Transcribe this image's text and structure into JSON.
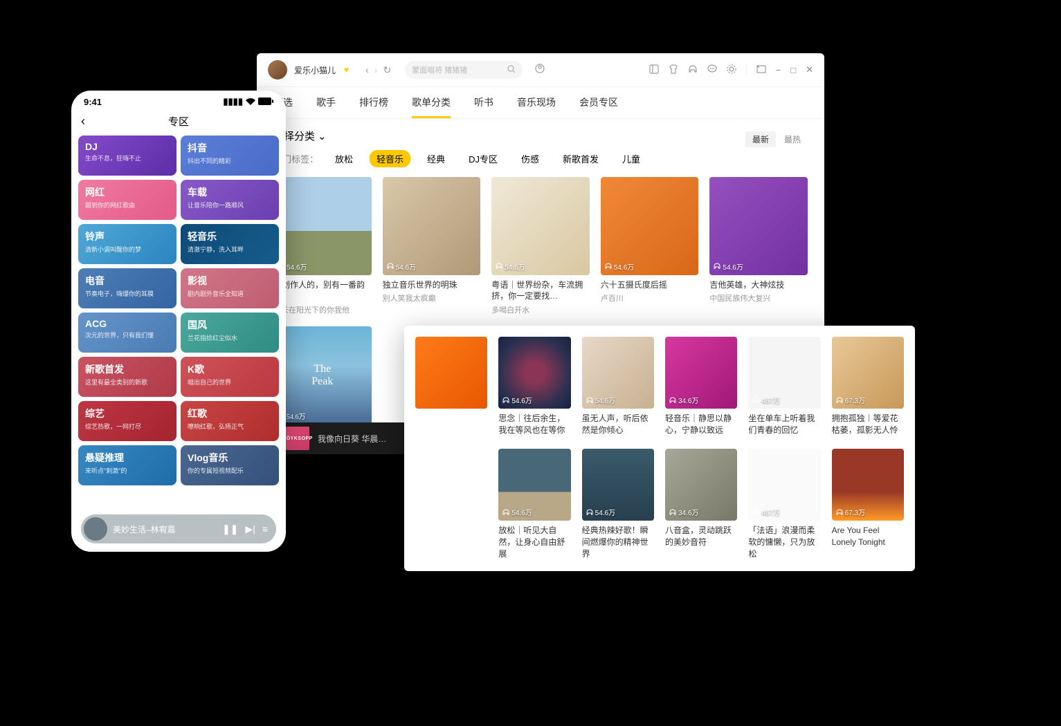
{
  "mobile": {
    "time": "9:41",
    "title": "专区",
    "categories": [
      {
        "title": "DJ",
        "sub": "生命不息，狂嗨不止",
        "cls": "c-dj"
      },
      {
        "title": "抖音",
        "sub": "抖出不同的精彩",
        "cls": "c-douyin"
      },
      {
        "title": "网红",
        "sub": "甜到你的网红歌曲",
        "cls": "c-wanghong"
      },
      {
        "title": "车载",
        "sub": "让音乐陪你一路顺风",
        "cls": "c-chezai"
      },
      {
        "title": "铃声",
        "sub": "清新小调叫醒你的梦",
        "cls": "c-lingsheng"
      },
      {
        "title": "轻音乐",
        "sub": "清澈宁静，洗入耳畔",
        "cls": "c-qingyinyue"
      },
      {
        "title": "电音",
        "sub": "节奏电子，嗨爆你的耳膜",
        "cls": "c-dianyin"
      },
      {
        "title": "影视",
        "sub": "剧内剧外音乐全知道",
        "cls": "c-yingshi"
      },
      {
        "title": "ACG",
        "sub": "次元的世界，只有我们懂",
        "cls": "c-acg"
      },
      {
        "title": "国风",
        "sub": "兰花指捻红尘似水",
        "cls": "c-guofeng"
      },
      {
        "title": "新歌首发",
        "sub": "这里有最全类别的新歌",
        "cls": "c-xinge"
      },
      {
        "title": "K歌",
        "sub": "唱出自己的世界",
        "cls": "c-kge"
      },
      {
        "title": "综艺",
        "sub": "综艺热歌，一网打尽",
        "cls": "c-zongyi"
      },
      {
        "title": "红歌",
        "sub": "嘹响红歌，弘扬正气",
        "cls": "c-hongge"
      },
      {
        "title": "悬疑推理",
        "sub": "来听点\"刺激\"的",
        "cls": "c-xuanyi"
      },
      {
        "title": "Vlog音乐",
        "sub": "你的专属短视频配乐",
        "cls": "c-vlog"
      }
    ],
    "now_playing": "美妙生活–林宥嘉"
  },
  "desktop": {
    "username": "爱乐小猫儿",
    "search_placeholder": "蒙面唱将 猪猪猪",
    "tabs": [
      "精选",
      "歌手",
      "排行榜",
      "歌单分类",
      "听书",
      "音乐现场",
      "会员专区"
    ],
    "active_tab": 3,
    "section_title": "选择分类",
    "sort": {
      "newest": "最新",
      "hottest": "最热"
    },
    "tag_label": "热门标签：",
    "tags": [
      "放松",
      "轻音乐",
      "经典",
      "DJ专区",
      "伤感",
      "新歌首发",
      "儿童"
    ],
    "active_tag": 1,
    "playlists_row1": [
      {
        "plays": "54.6万",
        "title": "听创作人的，别有一番韵味",
        "sub": "生长在阳光下的你我他",
        "cover": "pc-sky"
      },
      {
        "plays": "54.6万",
        "title": "独立音乐世界的明珠",
        "sub": "别人笑我太疯癫",
        "cover": "pc-girl"
      },
      {
        "plays": "54.6万",
        "title": "粤语｜世界纷杂，车流拥挤，你一定要找…",
        "sub": "多喝白开水",
        "cover": "pc-shapes"
      },
      {
        "plays": "54.6万",
        "title": "六十五摄氏度后摇",
        "sub": "卢百川",
        "cover": "pc-orange"
      },
      {
        "plays": "54.6万",
        "title": "吉他英雄，大神炫技",
        "sub": "中国民族伟大复兴",
        "cover": "pc-glasses"
      }
    ],
    "peak": {
      "line1": "The",
      "line2": "Peak",
      "plays": "54.6万"
    },
    "player_song": "我像向日葵 华晨…"
  },
  "panel": {
    "row1": [
      {
        "plays": "",
        "title": "",
        "cover": "pc-oranger",
        "show_plays": false
      },
      {
        "plays": "54.6万",
        "title": "思念｜往后余生，我在等风也在等你",
        "cover": "pc-disc",
        "show_plays": true
      },
      {
        "plays": "54.6万",
        "title": "虽无人声，听后依然是你倾心",
        "cover": "pc-solo",
        "show_plays": true
      },
      {
        "plays": "34.6万",
        "title": "轻音乐｜静思以静心，宁静以致远",
        "cover": "pc-escape",
        "show_plays": true
      },
      {
        "plays": "467万",
        "title": "坐在单车上听着我们青春的回忆",
        "cover": "pc-white",
        "show_plays": true
      },
      {
        "plays": "67.3万",
        "title": "拥抱孤独｜等爱花枯萎，孤影无人怜",
        "cover": "pc-skin",
        "show_plays": true
      }
    ],
    "row2": [
      {
        "plays": "",
        "title": "",
        "cover": "",
        "hidden": true
      },
      {
        "plays": "54.6万",
        "title": "放松｜听见大自然，让身心自由舒展",
        "cover": "pc-dragons"
      },
      {
        "plays": "54.6万",
        "title": "经典热辣好歌！瞬间燃爆你的精神世界",
        "cover": "pc-fatrat"
      },
      {
        "plays": "34.6万",
        "title": "八音盒，灵动跳跃的美妙音符",
        "cover": "pc-native"
      },
      {
        "plays": "467万",
        "title": "「法语」浪漫而柔软的慵懒，只为放松",
        "cover": "pc-we"
      },
      {
        "plays": "67.3万",
        "title": "Are You Feel Lonely Tonight",
        "cover": "pc-perry"
      }
    ]
  }
}
